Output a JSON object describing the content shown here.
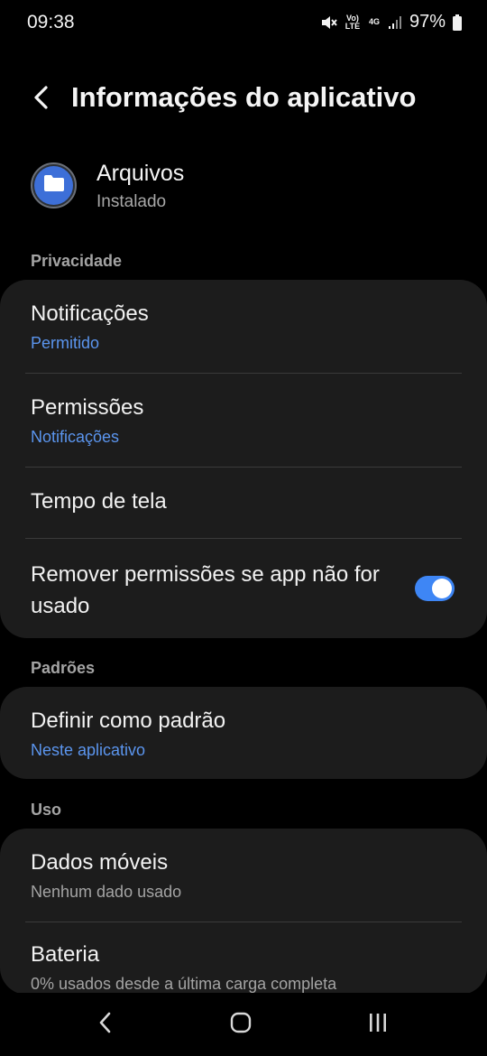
{
  "status_bar": {
    "time": "09:38",
    "network_volte": "Vo) LTE",
    "network_type": "4G",
    "battery_percent": "97%",
    "icons": [
      "mute-icon",
      "volte-icon",
      "4g-icon",
      "signal-icon",
      "battery-icon"
    ]
  },
  "header": {
    "title": "Informações do aplicativo",
    "back_icon": "chevron-left-icon"
  },
  "app": {
    "name": "Arquivos",
    "status": "Instalado",
    "icon": "folder-icon"
  },
  "sections": {
    "privacy": {
      "label": "Privacidade",
      "items": [
        {
          "title": "Notificações",
          "subtitle": "Permitido"
        },
        {
          "title": "Permissões",
          "subtitle": "Notificações"
        },
        {
          "title": "Tempo de tela"
        },
        {
          "title": "Remover permissões se app não for usado",
          "toggle_on": true
        }
      ]
    },
    "defaults": {
      "label": "Padrões",
      "items": [
        {
          "title": "Definir como padrão",
          "subtitle": "Neste aplicativo"
        }
      ]
    },
    "usage": {
      "label": "Uso",
      "items": [
        {
          "title": "Dados móveis",
          "subtitle": "Nenhum dado usado"
        },
        {
          "title": "Bateria",
          "subtitle": "0% usados desde a última carga completa"
        }
      ]
    }
  },
  "nav_bar": {
    "icons": [
      "back-nav-icon",
      "home-nav-icon",
      "recents-nav-icon"
    ]
  },
  "colors": {
    "background": "#000000",
    "card": "#1c1c1c",
    "accent": "#5b95ee",
    "toggle": "#3e86f5"
  }
}
